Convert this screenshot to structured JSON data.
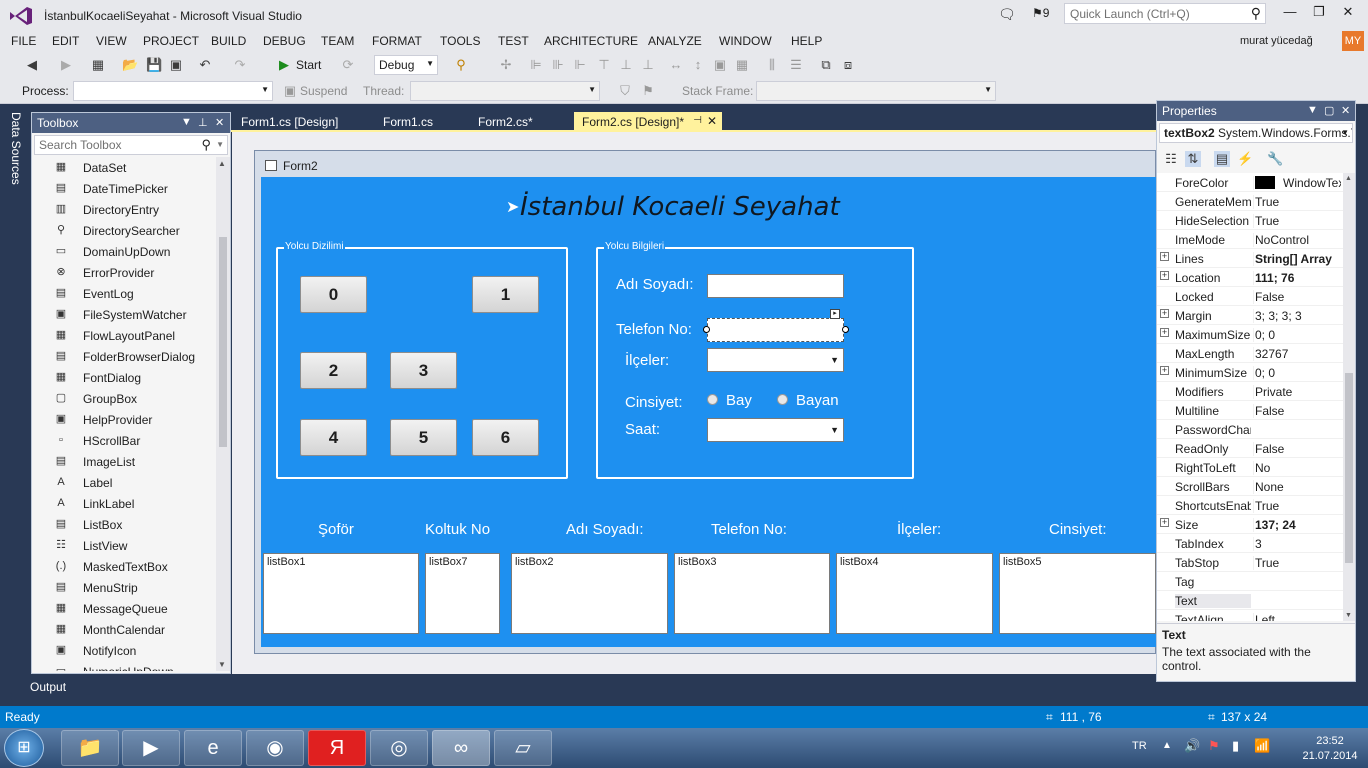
{
  "window": {
    "title": "İstanbulKocaeliSeyahat - Microsoft Visual Studio",
    "notif_count": "9",
    "quick_launch_placeholder": "Quick Launch (Ctrl+Q)"
  },
  "menu": [
    "FILE",
    "EDIT",
    "VIEW",
    "PROJECT",
    "BUILD",
    "DEBUG",
    "TEAM",
    "FORMAT",
    "TOOLS",
    "TEST",
    "ARCHITECTURE",
    "ANALYZE",
    "WINDOW",
    "HELP"
  ],
  "user": {
    "name": "murat yücedağ",
    "initials": "MY"
  },
  "toolbar": {
    "start_label": "Start",
    "config": "Debug",
    "process_label": "Process:",
    "suspend_label": "Suspend",
    "thread_label": "Thread:",
    "stack_frame_label": "Stack Frame:"
  },
  "side_tab": "Data Sources",
  "toolbox": {
    "title": "Toolbox",
    "search_placeholder": "Search Toolbox",
    "items": [
      {
        "label": "DataSet",
        "icon": "▦"
      },
      {
        "label": "DateTimePicker",
        "icon": "▤"
      },
      {
        "label": "DirectoryEntry",
        "icon": "▥"
      },
      {
        "label": "DirectorySearcher",
        "icon": "⚲"
      },
      {
        "label": "DomainUpDown",
        "icon": "▭"
      },
      {
        "label": "ErrorProvider",
        "icon": "⊗"
      },
      {
        "label": "EventLog",
        "icon": "▤"
      },
      {
        "label": "FileSystemWatcher",
        "icon": "▣"
      },
      {
        "label": "FlowLayoutPanel",
        "icon": "▦"
      },
      {
        "label": "FolderBrowserDialog",
        "icon": "▤"
      },
      {
        "label": "FontDialog",
        "icon": "▦"
      },
      {
        "label": "GroupBox",
        "icon": "▢"
      },
      {
        "label": "HelpProvider",
        "icon": "▣"
      },
      {
        "label": "HScrollBar",
        "icon": "▫"
      },
      {
        "label": "ImageList",
        "icon": "▤"
      },
      {
        "label": "Label",
        "icon": "A"
      },
      {
        "label": "LinkLabel",
        "icon": "A"
      },
      {
        "label": "ListBox",
        "icon": "▤"
      },
      {
        "label": "ListView",
        "icon": "☷"
      },
      {
        "label": "MaskedTextBox",
        "icon": "(.)"
      },
      {
        "label": "MenuStrip",
        "icon": "▤"
      },
      {
        "label": "MessageQueue",
        "icon": "▦"
      },
      {
        "label": "MonthCalendar",
        "icon": "▦"
      },
      {
        "label": "NotifyIcon",
        "icon": "▣"
      },
      {
        "label": "NumericUpDown",
        "icon": "▭"
      }
    ]
  },
  "tabs": [
    {
      "label": "Form1.cs [Design]"
    },
    {
      "label": "Form1.cs"
    },
    {
      "label": "Form2.cs*"
    },
    {
      "label": "Form2.cs [Design]*"
    }
  ],
  "form": {
    "window_title": "Form2",
    "heading": "İstanbul Kocaeli Seyahat",
    "group1": {
      "caption": "Yolcu Dizilimi",
      "seats": [
        "0",
        "1",
        "2",
        "3",
        "4",
        "5",
        "6"
      ]
    },
    "group2": {
      "caption": "Yolcu Bilgileri",
      "name_label": "Adı Soyadı:",
      "phone_label": "Telefon No:",
      "district_label": "İlçeler:",
      "gender_label": "Cinsiyet:",
      "male": "Bay",
      "female": "Bayan",
      "time_label": "Saat:"
    },
    "columns": [
      "Şoför",
      "Koltuk No",
      "Adı Soyadı:",
      "Telefon No:",
      "İlçeler:",
      "Cinsiyet:"
    ],
    "listboxes": [
      "listBox1",
      "listBox7",
      "listBox2",
      "listBox3",
      "listBox4",
      "listBox5"
    ]
  },
  "properties": {
    "title": "Properties",
    "object_name": "textBox2",
    "object_type": "System.Windows.Forms.TextBox",
    "rows": [
      {
        "name": "ForeColor",
        "value": "WindowText",
        "expand": false,
        "bold": false,
        "swatch": "#000000"
      },
      {
        "name": "GenerateMember",
        "value": "True",
        "expand": false,
        "bold": false
      },
      {
        "name": "HideSelection",
        "value": "True",
        "expand": false,
        "bold": false
      },
      {
        "name": "ImeMode",
        "value": "NoControl",
        "expand": false,
        "bold": false
      },
      {
        "name": "Lines",
        "value": "String[] Array",
        "expand": true,
        "bold": true
      },
      {
        "name": "Location",
        "value": "111; 76",
        "expand": true,
        "bold": true
      },
      {
        "name": "Locked",
        "value": "False",
        "expand": false,
        "bold": false
      },
      {
        "name": "Margin",
        "value": "3; 3; 3; 3",
        "expand": true,
        "bold": false
      },
      {
        "name": "MaximumSize",
        "value": "0; 0",
        "expand": true,
        "bold": false
      },
      {
        "name": "MaxLength",
        "value": "32767",
        "expand": false,
        "bold": false
      },
      {
        "name": "MinimumSize",
        "value": "0; 0",
        "expand": true,
        "bold": false
      },
      {
        "name": "Modifiers",
        "value": "Private",
        "expand": false,
        "bold": false
      },
      {
        "name": "Multiline",
        "value": "False",
        "expand": false,
        "bold": false
      },
      {
        "name": "PasswordChar",
        "value": "",
        "expand": false,
        "bold": false
      },
      {
        "name": "ReadOnly",
        "value": "False",
        "expand": false,
        "bold": false
      },
      {
        "name": "RightToLeft",
        "value": "No",
        "expand": false,
        "bold": false
      },
      {
        "name": "ScrollBars",
        "value": "None",
        "expand": false,
        "bold": false
      },
      {
        "name": "ShortcutsEnabled",
        "value": "True",
        "expand": false,
        "bold": false
      },
      {
        "name": "Size",
        "value": "137; 24",
        "expand": true,
        "bold": true
      },
      {
        "name": "TabIndex",
        "value": "3",
        "expand": false,
        "bold": false
      },
      {
        "name": "TabStop",
        "value": "True",
        "expand": false,
        "bold": false
      },
      {
        "name": "Tag",
        "value": "",
        "expand": false,
        "bold": false
      },
      {
        "name": "Text",
        "value": "",
        "expand": false,
        "bold": false,
        "selected": true
      },
      {
        "name": "TextAlign",
        "value": "Left",
        "expand": false,
        "bold": false
      }
    ],
    "desc_title": "Text",
    "desc_text": "The text associated with the control."
  },
  "output_tab": "Output",
  "status": {
    "ready": "Ready",
    "position": "111 , 76",
    "size": "137 x 24"
  },
  "taskbar": {
    "lang": "TR",
    "time": "23:52",
    "date": "21.07.2014"
  }
}
